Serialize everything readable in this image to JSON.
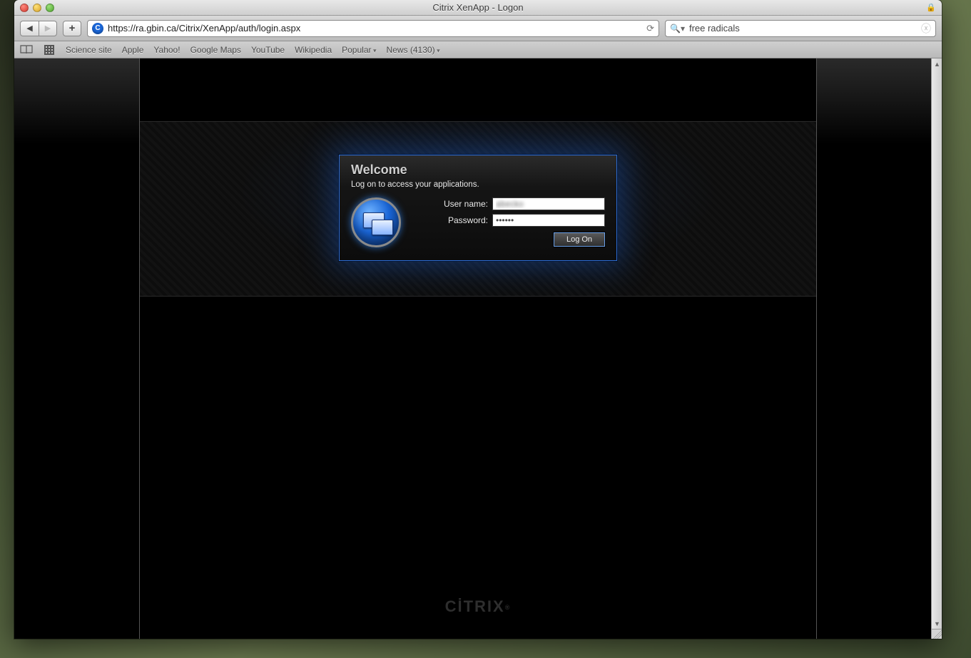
{
  "window": {
    "title": "Citrix XenApp - Logon"
  },
  "toolbar": {
    "url": "https://ra.gbin.ca/Citrix/XenApp/auth/login.aspx",
    "search_value": "free radicals"
  },
  "bookmarks": [
    {
      "label": "Science site",
      "dropdown": false
    },
    {
      "label": "Apple",
      "dropdown": false
    },
    {
      "label": "Yahoo!",
      "dropdown": false
    },
    {
      "label": "Google Maps",
      "dropdown": false
    },
    {
      "label": "YouTube",
      "dropdown": false
    },
    {
      "label": "Wikipedia",
      "dropdown": false
    },
    {
      "label": "Popular",
      "dropdown": true
    },
    {
      "label": "News (4130)",
      "dropdown": true
    }
  ],
  "login": {
    "title": "Welcome",
    "subtitle": "Log on to access your applications.",
    "username_label": "User name:",
    "password_label": "Password:",
    "username_value": "abecko",
    "password_value": "••••••",
    "button_label": "Log On"
  },
  "footer": {
    "brand": "CİTRIX"
  }
}
